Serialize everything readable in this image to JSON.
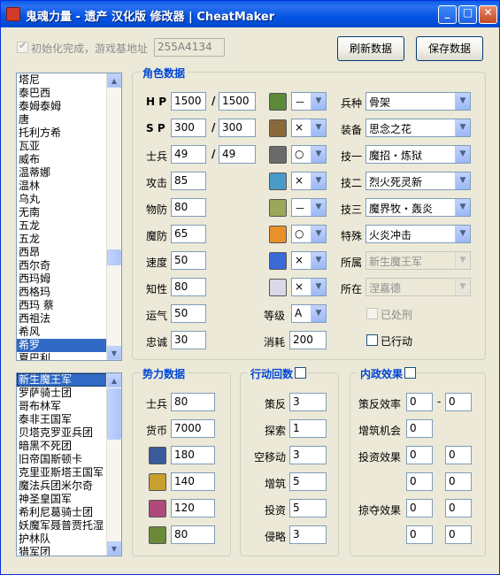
{
  "window": {
    "title": "鬼魂力量 - 遗产 汉化版 修改器 | CheatMaker",
    "min": "_",
    "max": "□",
    "close": "✕"
  },
  "top": {
    "init_label": "初始化完成，游戏基地址",
    "base_addr": "255A4134",
    "refresh": "刷新数据",
    "save": "保存数据"
  },
  "list1": {
    "items": [
      "塔尼",
      "泰巴西",
      "泰姆泰姆",
      "唐",
      "托利方希",
      "瓦亚",
      "威布",
      "温蒂娜",
      "温林",
      "乌丸",
      "无南",
      "五龙",
      "五龙",
      "西昂",
      "西尔奇",
      "西玛姆",
      "西格玛",
      "西玛 蔡",
      "西祖法",
      "希风",
      "希罗",
      "夏巴利"
    ],
    "selected_index": 20
  },
  "list2": {
    "items": [
      "新生魔王军",
      "罗萨骑士团",
      "哥布林军",
      "泰非王国军",
      "贝塔克罗亚兵团",
      "暗黑不死团",
      "旧帝国斯顿卡",
      "克里亚斯塔王国军",
      "魔法兵团米尔奇",
      "神圣皇国军",
      "希利尼葛骑士团",
      "妖魔军聂普贾托湿",
      "护林队",
      "猎军团"
    ],
    "selected_index": 0
  },
  "char": {
    "caption": "角色数据",
    "hp": {
      "label": "H P",
      "cur": "1500",
      "max": "1500"
    },
    "sp": {
      "label": "S P",
      "cur": "300",
      "max": "300"
    },
    "soldier": {
      "label": "士兵",
      "cur": "49",
      "max": "49"
    },
    "sep": "/",
    "attack": {
      "label": "攻击",
      "value": "85"
    },
    "pdef": {
      "label": "物防",
      "value": "80"
    },
    "mdef": {
      "label": "魔防",
      "value": "65"
    },
    "speed": {
      "label": "速度",
      "value": "50"
    },
    "intel": {
      "label": "知性",
      "value": "80"
    },
    "luck": {
      "label": "运气",
      "value": "50"
    },
    "loyal": {
      "label": "忠诚",
      "value": "30"
    },
    "level": {
      "label": "等级",
      "value": "A"
    },
    "cost": {
      "label": "消耗",
      "value": "200"
    },
    "affinities": [
      {
        "icon": "grass-terrain-icon",
        "value": "－"
      },
      {
        "icon": "hill-terrain-icon",
        "value": "×"
      },
      {
        "icon": "rock-terrain-icon",
        "value": "○"
      },
      {
        "icon": "water-terrain-icon",
        "value": "×"
      },
      {
        "icon": "field-terrain-icon",
        "value": "－"
      },
      {
        "icon": "sun-icon",
        "value": "○"
      },
      {
        "icon": "ice-icon",
        "value": "×"
      },
      {
        "icon": "wind-icon",
        "value": "×"
      }
    ],
    "unit_type": {
      "label": "兵种",
      "value": "骨架"
    },
    "equip": {
      "label": "装备",
      "value": "思念之花"
    },
    "skill1": {
      "label": "技一",
      "value": "魔招・炼狱"
    },
    "skill2": {
      "label": "技二",
      "value": "烈火死灵新"
    },
    "skill3": {
      "label": "技三",
      "value": "魔界牧・轰炎"
    },
    "special": {
      "label": "特殊",
      "value": "火炎冲击"
    },
    "belong": {
      "label": "所属",
      "value": "新生魔王军"
    },
    "location": {
      "label": "所在",
      "value": "涅嘉德"
    },
    "punished": "已处刑",
    "acted": "已行动"
  },
  "power": {
    "caption": "势力数据",
    "soldier": {
      "label": "士兵",
      "value": "80"
    },
    "money": {
      "label": "货币",
      "value": "7000"
    },
    "res": [
      {
        "icon": "crystal-icon",
        "value": "180"
      },
      {
        "icon": "gold-icon",
        "value": "140"
      },
      {
        "icon": "potion-icon",
        "value": "120"
      },
      {
        "icon": "scroll-icon",
        "value": "80"
      }
    ]
  },
  "actions": {
    "caption": "行动回数",
    "rows": [
      {
        "label": "策反",
        "value": "3"
      },
      {
        "label": "探索",
        "value": "1"
      },
      {
        "label": "空移动",
        "value": "3"
      },
      {
        "label": "增筑",
        "value": "5"
      },
      {
        "label": "投资",
        "value": "5"
      },
      {
        "label": "侵略",
        "value": "3"
      }
    ]
  },
  "domestic": {
    "caption": "内政效果",
    "rebel": {
      "label": "策反效率",
      "a": "0",
      "b": "0",
      "dash": "-"
    },
    "build": {
      "label": "增筑机会",
      "a": "0"
    },
    "invest": {
      "label": "投资效果",
      "a": "0",
      "b": "0",
      "c": "0",
      "d": "0"
    },
    "plunder": {
      "label": "掠夺效果",
      "a": "0",
      "b": "0",
      "c": "0",
      "d": "0"
    }
  }
}
